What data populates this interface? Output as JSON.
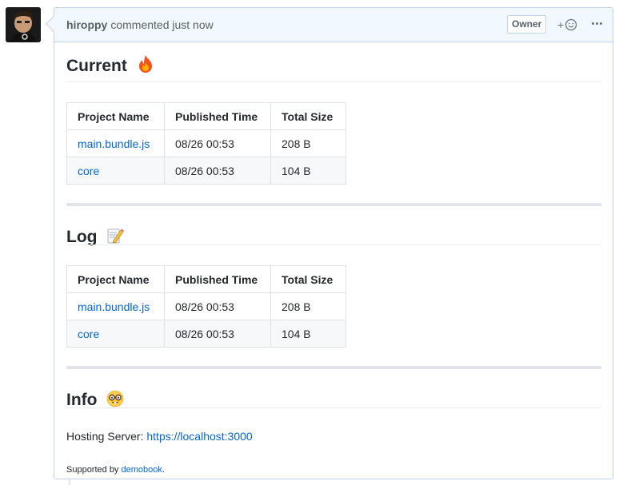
{
  "comment": {
    "author": "hiroppy",
    "action": "commented just now",
    "badge": "Owner",
    "reaction_plus": "+"
  },
  "sections": {
    "current": {
      "title": "Current",
      "icon": "fire-icon"
    },
    "log": {
      "title": "Log",
      "icon": "memo-icon"
    },
    "info": {
      "title": "Info",
      "icon": "nerd-face-icon"
    }
  },
  "table_headers": [
    "Project Name",
    "Published Time",
    "Total Size"
  ],
  "current_rows": [
    {
      "project": "main.bundle.js",
      "time": "08/26 00:53",
      "size": "208 B"
    },
    {
      "project": "core",
      "time": "08/26 00:53",
      "size": "104 B"
    }
  ],
  "log_rows": [
    {
      "project": "main.bundle.js",
      "time": "08/26 00:53",
      "size": "208 B"
    },
    {
      "project": "core",
      "time": "08/26 00:53",
      "size": "104 B"
    }
  ],
  "info": {
    "server_label": "Hosting Server:",
    "server_url": "https://localhost:3000",
    "supported_prefix": "Supported by",
    "supported_link": "demobook",
    "supported_suffix": "."
  },
  "colors": {
    "link": "#0366d6",
    "header_bg": "#f1f8ff",
    "border": "#c0d3eb"
  }
}
